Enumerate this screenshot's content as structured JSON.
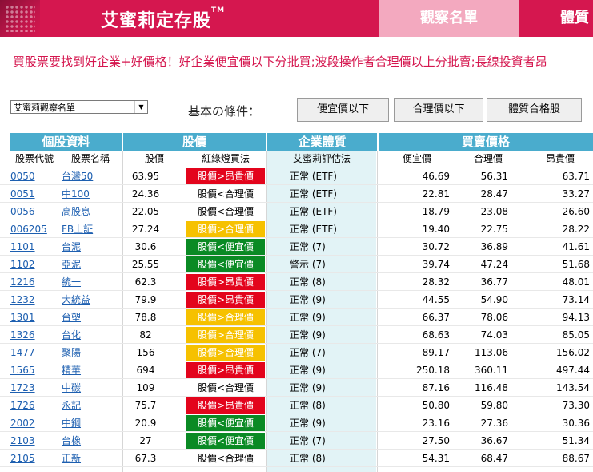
{
  "header": {
    "brand": "艾蜜莉定存股",
    "brand_mark": "TM",
    "tab_active": "觀察名單",
    "tab_next": "體質"
  },
  "marquee_text": "買股票要找到好企業+好價格！好企業便宜價以下分批買;波段操作者合理價以上分批賣;長線投資者昂",
  "controls": {
    "watchlist_select": "艾蜜莉觀察名單",
    "cond_label": "基本の條件：",
    "buttons": [
      "便宜價以下",
      "合理價以下",
      "體質合格股"
    ]
  },
  "table": {
    "groups": [
      "個股資料",
      "股價",
      "企業體質",
      "買賣價格"
    ],
    "columns": [
      "股票代號",
      "股票名稱",
      "股價",
      "紅綠燈買法",
      "艾蜜莉評估法",
      "便宜價",
      "合理價",
      "昂貴價"
    ],
    "colors": {
      "red": "#e3041c",
      "green": "#0a8a24",
      "yellow": "#f6c100",
      "header": "#4aaccd",
      "brand": "#d5174f"
    },
    "rows": [
      {
        "code": "0050",
        "name": "台灣50",
        "price": "63.95",
        "signal": "股價>昂貴價",
        "sig": "red",
        "eval": "正常 (ETF)",
        "cheap": "46.69",
        "fair": "56.31",
        "exp": "63.71"
      },
      {
        "code": "0051",
        "name": "中100",
        "price": "24.36",
        "signal": "股價<合理價",
        "sig": "white",
        "eval": "正常 (ETF)",
        "cheap": "22.81",
        "fair": "28.47",
        "exp": "33.27"
      },
      {
        "code": "0056",
        "name": "高股息",
        "price": "22.05",
        "signal": "股價<合理價",
        "sig": "white",
        "eval": "正常 (ETF)",
        "cheap": "18.79",
        "fair": "23.08",
        "exp": "26.60"
      },
      {
        "code": "006205",
        "name": "FB上証",
        "price": "27.24",
        "signal": "股價>合理價",
        "sig": "yellow",
        "eval": "正常 (ETF)",
        "cheap": "19.40",
        "fair": "22.75",
        "exp": "28.22"
      },
      {
        "code": "1101",
        "name": "台泥",
        "price": "30.6",
        "signal": "股價<便宜價",
        "sig": "green",
        "eval": "正常 (7)",
        "cheap": "30.72",
        "fair": "36.89",
        "exp": "41.61"
      },
      {
        "code": "1102",
        "name": "亞泥",
        "price": "25.55",
        "signal": "股價<便宜價",
        "sig": "green",
        "eval": "警示 (7)",
        "cheap": "39.74",
        "fair": "47.24",
        "exp": "51.68"
      },
      {
        "code": "1216",
        "name": "統一",
        "price": "62.3",
        "signal": "股價>昂貴價",
        "sig": "red",
        "eval": "正常 (8)",
        "cheap": "28.32",
        "fair": "36.77",
        "exp": "48.01"
      },
      {
        "code": "1232",
        "name": "大統益",
        "price": "79.9",
        "signal": "股價>昂貴價",
        "sig": "red",
        "eval": "正常 (9)",
        "cheap": "44.55",
        "fair": "54.90",
        "exp": "73.14"
      },
      {
        "code": "1301",
        "name": "台塑",
        "price": "78.8",
        "signal": "股價>合理價",
        "sig": "yellow",
        "eval": "正常 (9)",
        "cheap": "66.37",
        "fair": "78.06",
        "exp": "94.13"
      },
      {
        "code": "1326",
        "name": "台化",
        "price": "82",
        "signal": "股價>合理價",
        "sig": "yellow",
        "eval": "正常 (9)",
        "cheap": "68.63",
        "fair": "74.03",
        "exp": "85.05"
      },
      {
        "code": "1477",
        "name": "聚陽",
        "price": "156",
        "signal": "股價>合理價",
        "sig": "yellow",
        "eval": "正常 (7)",
        "cheap": "89.17",
        "fair": "113.06",
        "exp": "156.02"
      },
      {
        "code": "1565",
        "name": "精華",
        "price": "694",
        "signal": "股價>昂貴價",
        "sig": "red",
        "eval": "正常 (9)",
        "cheap": "250.18",
        "fair": "360.11",
        "exp": "497.44"
      },
      {
        "code": "1723",
        "name": "中碳",
        "price": "109",
        "signal": "股價<合理價",
        "sig": "white",
        "eval": "正常 (9)",
        "cheap": "87.16",
        "fair": "116.48",
        "exp": "143.54"
      },
      {
        "code": "1726",
        "name": "永記",
        "price": "75.7",
        "signal": "股價>昂貴價",
        "sig": "red",
        "eval": "正常 (8)",
        "cheap": "50.80",
        "fair": "59.80",
        "exp": "73.30"
      },
      {
        "code": "2002",
        "name": "中鋼",
        "price": "20.9",
        "signal": "股價<便宜價",
        "sig": "green",
        "eval": "正常 (9)",
        "cheap": "23.16",
        "fair": "27.36",
        "exp": "30.36"
      },
      {
        "code": "2103",
        "name": "台橡",
        "price": "27",
        "signal": "股價<便宜價",
        "sig": "green",
        "eval": "正常 (7)",
        "cheap": "27.50",
        "fair": "36.67",
        "exp": "51.34"
      },
      {
        "code": "2105",
        "name": "正新",
        "price": "67.3",
        "signal": "股價<合理價",
        "sig": "white",
        "eval": "正常 (8)",
        "cheap": "54.31",
        "fair": "68.47",
        "exp": "88.67"
      }
    ]
  }
}
